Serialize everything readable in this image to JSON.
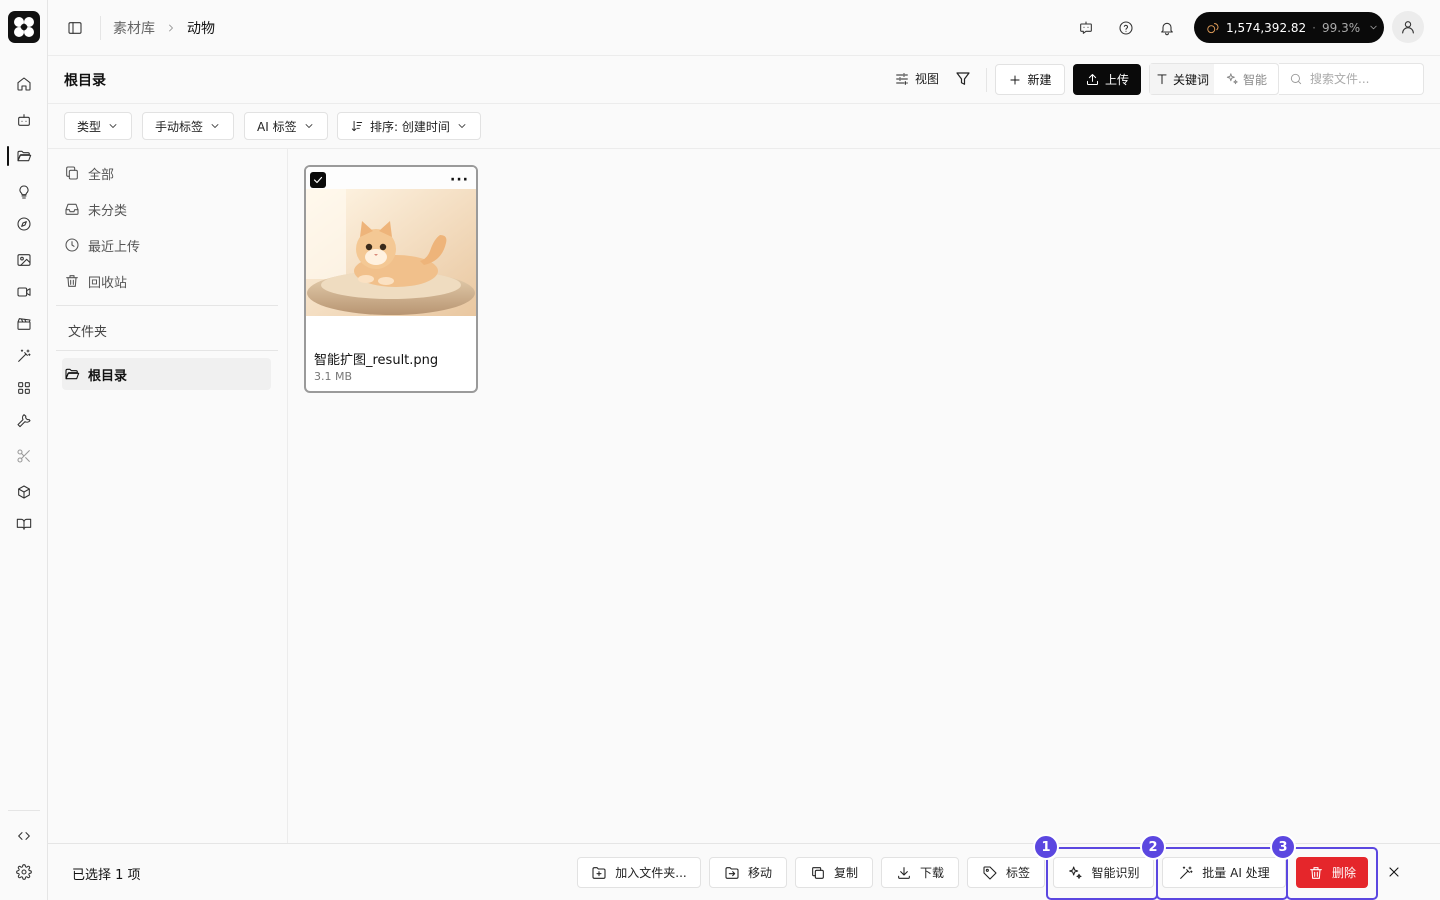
{
  "topbar": {
    "breadcrumb_parent": "素材库",
    "breadcrumb_current": "动物",
    "credits_amount": "1,574,392.82",
    "credits_dot": "·",
    "credits_percent": "99.3%"
  },
  "header": {
    "title": "根目录",
    "view_label": "视图",
    "new_label": "新建",
    "upload_label": "上传",
    "mode_keyword": "关键词",
    "mode_smart": "智能",
    "search_placeholder": "搜索文件..."
  },
  "filters": {
    "type": "类型",
    "manual_tags": "手动标签",
    "ai_tags": "AI 标签",
    "sort": "排序: 创建时间"
  },
  "sidebar": {
    "items": [
      {
        "label": "全部",
        "icon": "copy-icon"
      },
      {
        "label": "未分类",
        "icon": "inbox-icon"
      },
      {
        "label": "最近上传",
        "icon": "clock-icon"
      },
      {
        "label": "回收站",
        "icon": "trash-icon"
      }
    ],
    "folders_title": "文件夹",
    "root_folder": "根目录"
  },
  "files": [
    {
      "name": "智能扩图_result.png",
      "size": "3.1 MB",
      "selected": true
    }
  ],
  "actionbar": {
    "selected_text": "已选择 1 项",
    "add_to_folder": "加入文件夹...",
    "move": "移动",
    "copy": "复制",
    "download": "下载",
    "tag": "标签",
    "smart_recognize": "智能识别",
    "batch_ai": "批量 AI 处理",
    "delete": "删除",
    "badges": [
      "1",
      "2",
      "3"
    ]
  },
  "colors": {
    "accent": "#5b47e0",
    "danger": "#e5262b",
    "primary": "#0a0a0a"
  }
}
